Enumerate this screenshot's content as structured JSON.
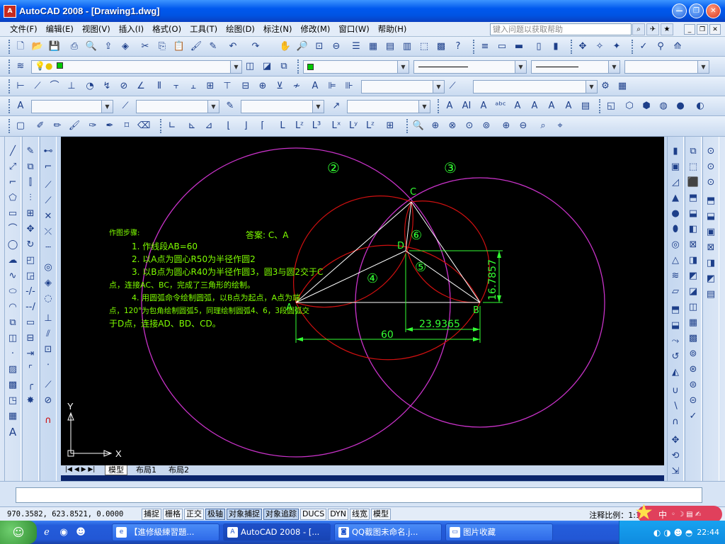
{
  "window": {
    "app_icon": "A",
    "title": "AutoCAD 2008 - [Drawing1.dwg]",
    "controls": [
      "minimize-icon",
      "restore-icon",
      "close-icon"
    ]
  },
  "menubar": {
    "items": [
      "文件(F)",
      "编辑(E)",
      "视图(V)",
      "插入(I)",
      "格式(O)",
      "工具(T)",
      "绘图(D)",
      "标注(N)",
      "修改(M)",
      "窗口(W)",
      "帮助(H)"
    ],
    "help_placeholder": "键入问题以获取帮助"
  },
  "drawing": {
    "colors": {
      "circle": "#c832c8",
      "arc": "#d01010",
      "line": "#ffffff",
      "dim": "#33ff33",
      "text": "#7fff00"
    },
    "point_labels": {
      "A": "A",
      "B": "B",
      "C": "C",
      "D": "D"
    },
    "circle_labels": {
      "c2": "②",
      "c3": "③",
      "c4": "④",
      "c5": "⑤",
      "c6": "⑥"
    },
    "dimensions": {
      "ab": "60",
      "db": "23.9365",
      "d_height": "16.7857"
    },
    "notes": {
      "heading": "作图步骤:",
      "answer": "答案: C、A",
      "step1": "1. 作线段AB=60",
      "step2": "2. 以A点为圆心R50为半径作圆2",
      "step3a": "3. 以B点为圆心R40为半径作圆3，圆3与圆2交于C",
      "step3b": "点，连接AC、BC，完成了三角形的绘制。",
      "step4a": "4. 用圆弧命令绘制圆弧，以B点为起点，A点为端",
      "step4b": "点，120°为包角绘制圆弧5，同理绘制圆弧4、6，3段圆弧交",
      "step4c": "于D点，连接AD、BD、CD。"
    },
    "ucs": {
      "x": "X",
      "y": "Y"
    }
  },
  "layout_tabs": [
    "模型",
    "布局1",
    "布局2"
  ],
  "status": {
    "coords": "970.3582, 623.8521, 0.0000",
    "toggles": [
      {
        "label": "捕捉",
        "on": false
      },
      {
        "label": "栅格",
        "on": false
      },
      {
        "label": "正交",
        "on": false
      },
      {
        "label": "极轴",
        "on": true
      },
      {
        "label": "对象捕捉",
        "on": true
      },
      {
        "label": "对象追踪",
        "on": true
      },
      {
        "label": "DUCS",
        "on": false
      },
      {
        "label": "DYN",
        "on": false
      },
      {
        "label": "线宽",
        "on": false
      },
      {
        "label": "模型",
        "on": false
      }
    ],
    "annotation_scale": "注释比例：1:1 ▾"
  },
  "taskbar": {
    "tasks": [
      {
        "label": "【進修級練習題...",
        "icon": "ie-icon",
        "active": false
      },
      {
        "label": "AutoCAD 2008 - [...",
        "icon": "autocad-icon",
        "active": true
      },
      {
        "label": "QQ截图未命名.j...",
        "icon": "image-viewer-icon",
        "active": false
      },
      {
        "label": "图片收藏",
        "icon": "folder-icon",
        "active": false
      }
    ],
    "clock": "22:44",
    "ime": "中"
  }
}
